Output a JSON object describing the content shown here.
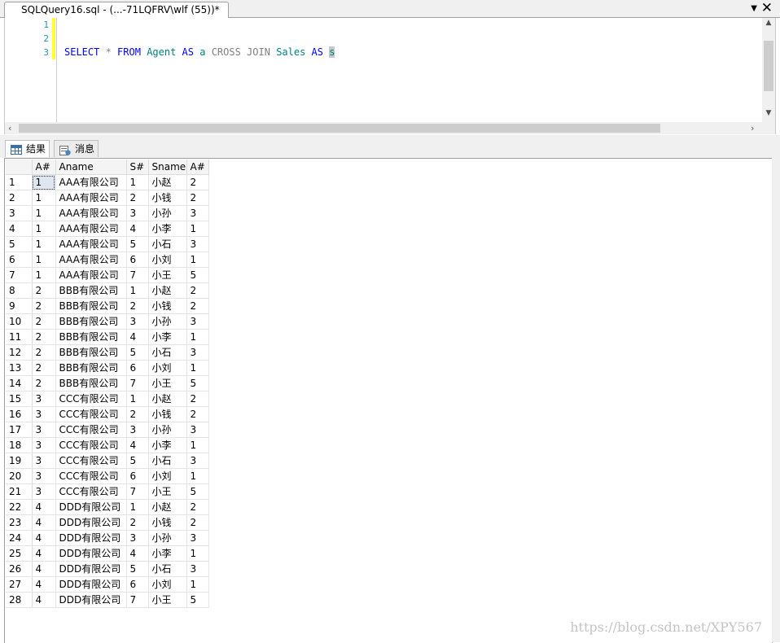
{
  "tab": {
    "title": "SQLQuery16.sql - (...-71LQFRV\\wlf (55))*",
    "dropdown_icon": "▼",
    "close_icon": "✕"
  },
  "editor": {
    "line_numbers": [
      "1",
      "2",
      "3"
    ],
    "tokens": [
      {
        "text": "SELECT",
        "cls": "kw"
      },
      {
        "text": " * ",
        "cls": "gray"
      },
      {
        "text": "FROM",
        "cls": "kw"
      },
      {
        "text": " ",
        "cls": ""
      },
      {
        "text": "Agent",
        "cls": "tbl"
      },
      {
        "text": " ",
        "cls": ""
      },
      {
        "text": "AS",
        "cls": "kw"
      },
      {
        "text": " ",
        "cls": ""
      },
      {
        "text": "a",
        "cls": "tbl"
      },
      {
        "text": " ",
        "cls": ""
      },
      {
        "text": "CROSS JOIN",
        "cls": "gray"
      },
      {
        "text": " ",
        "cls": ""
      },
      {
        "text": "Sales",
        "cls": "tbl"
      },
      {
        "text": " ",
        "cls": ""
      },
      {
        "text": "AS",
        "cls": "kw"
      },
      {
        "text": " ",
        "cls": ""
      }
    ],
    "selected_token": "s"
  },
  "results_tabs": {
    "results": "结果",
    "messages": "消息"
  },
  "grid": {
    "columns": [
      "",
      "A#",
      "Aname",
      "S#",
      "Sname",
      "A#"
    ],
    "rows": [
      [
        "1",
        "1",
        "AAA有限公司",
        "1",
        "小赵",
        "2"
      ],
      [
        "2",
        "1",
        "AAA有限公司",
        "2",
        "小钱",
        "2"
      ],
      [
        "3",
        "1",
        "AAA有限公司",
        "3",
        "小孙",
        "3"
      ],
      [
        "4",
        "1",
        "AAA有限公司",
        "4",
        "小李",
        "1"
      ],
      [
        "5",
        "1",
        "AAA有限公司",
        "5",
        "小石",
        "3"
      ],
      [
        "6",
        "1",
        "AAA有限公司",
        "6",
        "小刘",
        "1"
      ],
      [
        "7",
        "1",
        "AAA有限公司",
        "7",
        "小王",
        "5"
      ],
      [
        "8",
        "2",
        "BBB有限公司",
        "1",
        "小赵",
        "2"
      ],
      [
        "9",
        "2",
        "BBB有限公司",
        "2",
        "小钱",
        "2"
      ],
      [
        "10",
        "2",
        "BBB有限公司",
        "3",
        "小孙",
        "3"
      ],
      [
        "11",
        "2",
        "BBB有限公司",
        "4",
        "小李",
        "1"
      ],
      [
        "12",
        "2",
        "BBB有限公司",
        "5",
        "小石",
        "3"
      ],
      [
        "13",
        "2",
        "BBB有限公司",
        "6",
        "小刘",
        "1"
      ],
      [
        "14",
        "2",
        "BBB有限公司",
        "7",
        "小王",
        "5"
      ],
      [
        "15",
        "3",
        "CCC有限公司",
        "1",
        "小赵",
        "2"
      ],
      [
        "16",
        "3",
        "CCC有限公司",
        "2",
        "小钱",
        "2"
      ],
      [
        "17",
        "3",
        "CCC有限公司",
        "3",
        "小孙",
        "3"
      ],
      [
        "18",
        "3",
        "CCC有限公司",
        "4",
        "小李",
        "1"
      ],
      [
        "19",
        "3",
        "CCC有限公司",
        "5",
        "小石",
        "3"
      ],
      [
        "20",
        "3",
        "CCC有限公司",
        "6",
        "小刘",
        "1"
      ],
      [
        "21",
        "3",
        "CCC有限公司",
        "7",
        "小王",
        "5"
      ],
      [
        "22",
        "4",
        "DDD有限公司",
        "1",
        "小赵",
        "2"
      ],
      [
        "23",
        "4",
        "DDD有限公司",
        "2",
        "小钱",
        "2"
      ],
      [
        "24",
        "4",
        "DDD有限公司",
        "3",
        "小孙",
        "3"
      ],
      [
        "25",
        "4",
        "DDD有限公司",
        "4",
        "小李",
        "1"
      ],
      [
        "26",
        "4",
        "DDD有限公司",
        "5",
        "小石",
        "3"
      ],
      [
        "27",
        "4",
        "DDD有限公司",
        "6",
        "小刘",
        "1"
      ],
      [
        "28",
        "4",
        "DDD有限公司",
        "7",
        "小王",
        "5"
      ]
    ]
  },
  "watermark": "https://blog.csdn.net/XPY567"
}
